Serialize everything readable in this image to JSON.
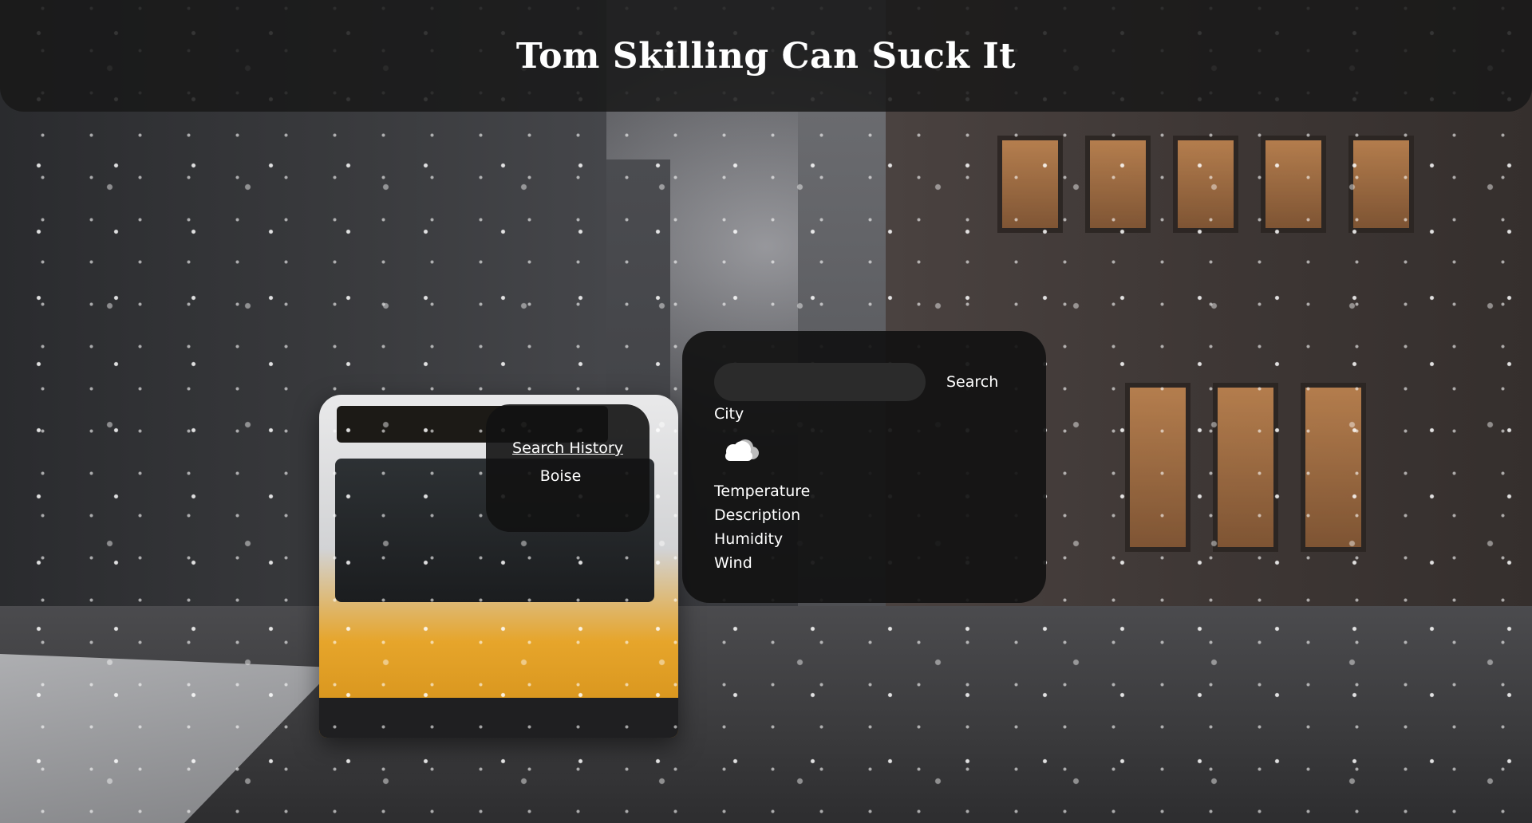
{
  "header": {
    "title": "Tom Skilling Can Suck It"
  },
  "history": {
    "title": "Search History",
    "items": [
      "Boise"
    ]
  },
  "search": {
    "value": "",
    "placeholder": "",
    "button_label": "Search"
  },
  "weather": {
    "city": "City",
    "icon": "cloud-icon",
    "temperature": "Temperature",
    "description": "Description",
    "humidity": "Humidity",
    "wind": "Wind"
  },
  "colors": {
    "panel_bg": "#121212",
    "text": "#ffffff",
    "input_bg": "#2b2b2b"
  }
}
